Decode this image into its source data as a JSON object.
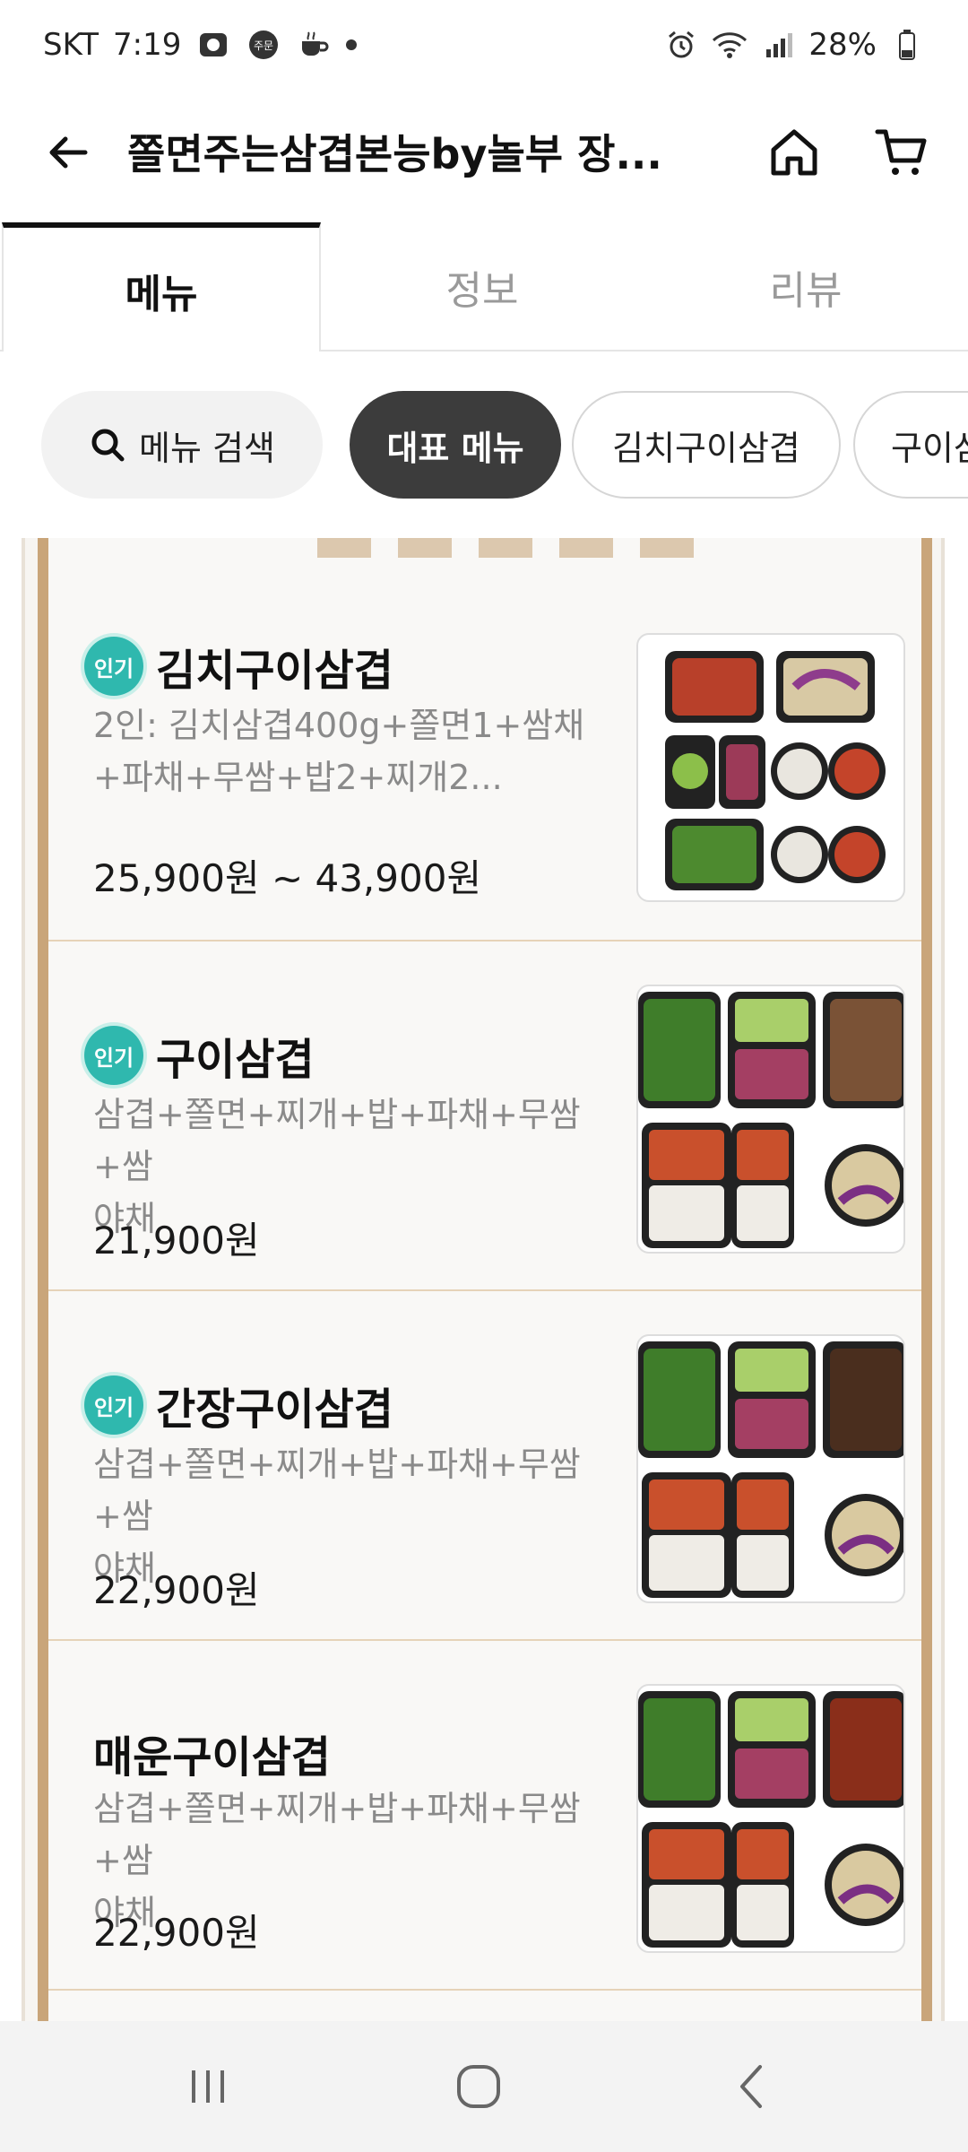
{
  "status_bar": {
    "carrier": "SKT",
    "time": "7:19",
    "notification_icons": [
      "photo-icon",
      "order-icon",
      "coffee-icon"
    ],
    "order_badge_text": "주문",
    "battery": "28%",
    "icons": [
      "alarm-icon",
      "wifi-icon",
      "signal-icon",
      "battery-icon"
    ]
  },
  "header": {
    "title": "쫄면주는삼겹본능by놀부 장...",
    "back_icon": "arrow-left-icon",
    "home_icon": "home-icon",
    "cart_icon": "cart-icon"
  },
  "tabs": [
    {
      "label": "메뉴",
      "active": true
    },
    {
      "label": "정보",
      "active": false
    },
    {
      "label": "리뷰",
      "active": false
    }
  ],
  "chips": {
    "search_label": "메뉴 검색",
    "items": [
      "대표 메뉴",
      "김치구이삼겹",
      "구이삼"
    ],
    "selected": "대표 메뉴"
  },
  "menu_items": [
    {
      "badge": "인기",
      "name": "김치구이삼겹",
      "desc_line1": "2인: 김치삼겹400g+쫄면1+쌈채",
      "desc_line2": "+파채+무쌈+밥2+찌개2...",
      "price": "25,900원 ~ 43,900원"
    },
    {
      "badge": "인기",
      "name": "구이삼겹",
      "desc_line1": "삼겹+쫄면+찌개+밥+파채+무쌈+쌈",
      "desc_line2": "야채",
      "price": "21,900원"
    },
    {
      "badge": "인기",
      "name": "간장구이삼겹",
      "desc_line1": "삼겹+쫄면+찌개+밥+파채+무쌈+쌈",
      "desc_line2": "야채",
      "price": "22,900원"
    },
    {
      "badge": "",
      "name": "매운구이삼겹",
      "desc_line1": "삼겹+쫄면+찌개+밥+파채+무쌈+쌈",
      "desc_line2": "야채",
      "price": "22,900원"
    }
  ],
  "colors": {
    "badge": "#2fb8ae",
    "frame": "#c9a57a",
    "chip_selected": "#3c3c3c"
  },
  "navbar": {
    "icons": [
      "recents-icon",
      "home-circle-icon",
      "back-chevron-icon"
    ]
  }
}
